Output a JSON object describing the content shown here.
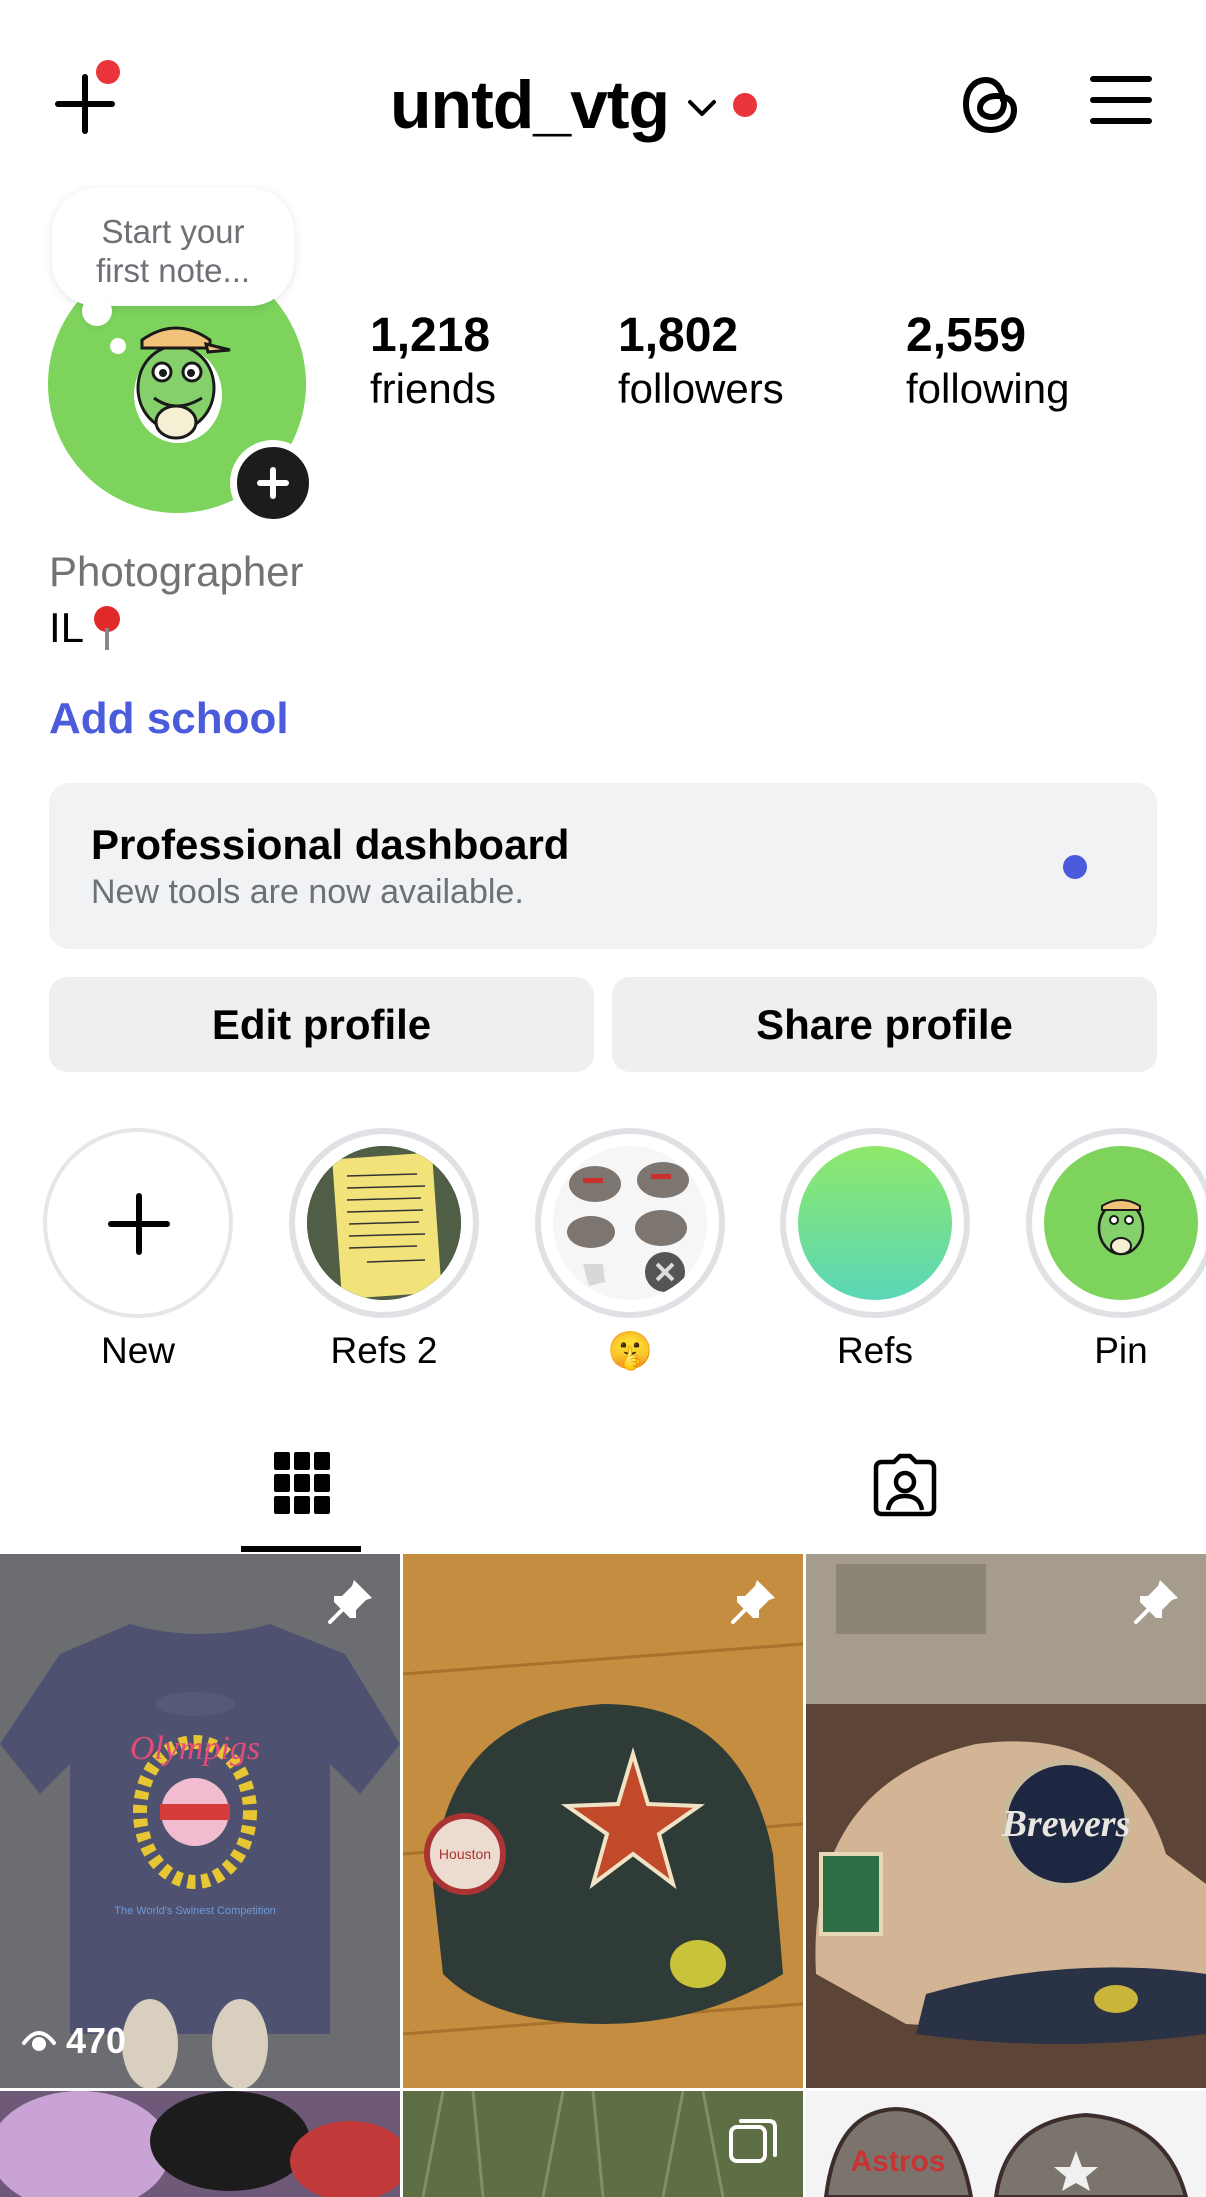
{
  "header": {
    "username": "untd_vtg"
  },
  "profile": {
    "note_placeholder_line1": "Start your",
    "note_placeholder_line2": "first note...",
    "stats": [
      {
        "value": "1,218",
        "label": "friends"
      },
      {
        "value": "1,802",
        "label": "followers"
      },
      {
        "value": "2,559",
        "label": "following"
      }
    ],
    "category": "Photographer",
    "bio_text": "IL",
    "add_school": "Add school"
  },
  "dashboard": {
    "title": "Professional dashboard",
    "subtitle": "New tools are now available."
  },
  "buttons": {
    "edit_profile": "Edit profile",
    "share_profile": "Share profile"
  },
  "highlights": [
    {
      "label": "New"
    },
    {
      "label": "Refs 2"
    },
    {
      "label": "🤫"
    },
    {
      "label": "Refs"
    },
    {
      "label": "Pin"
    }
  ],
  "posts": {
    "first_post_views": "470"
  },
  "colors": {
    "accent_blue": "#4a5bdc",
    "notification_red": "#e8343a",
    "avatar_green": "#7dd35c"
  }
}
